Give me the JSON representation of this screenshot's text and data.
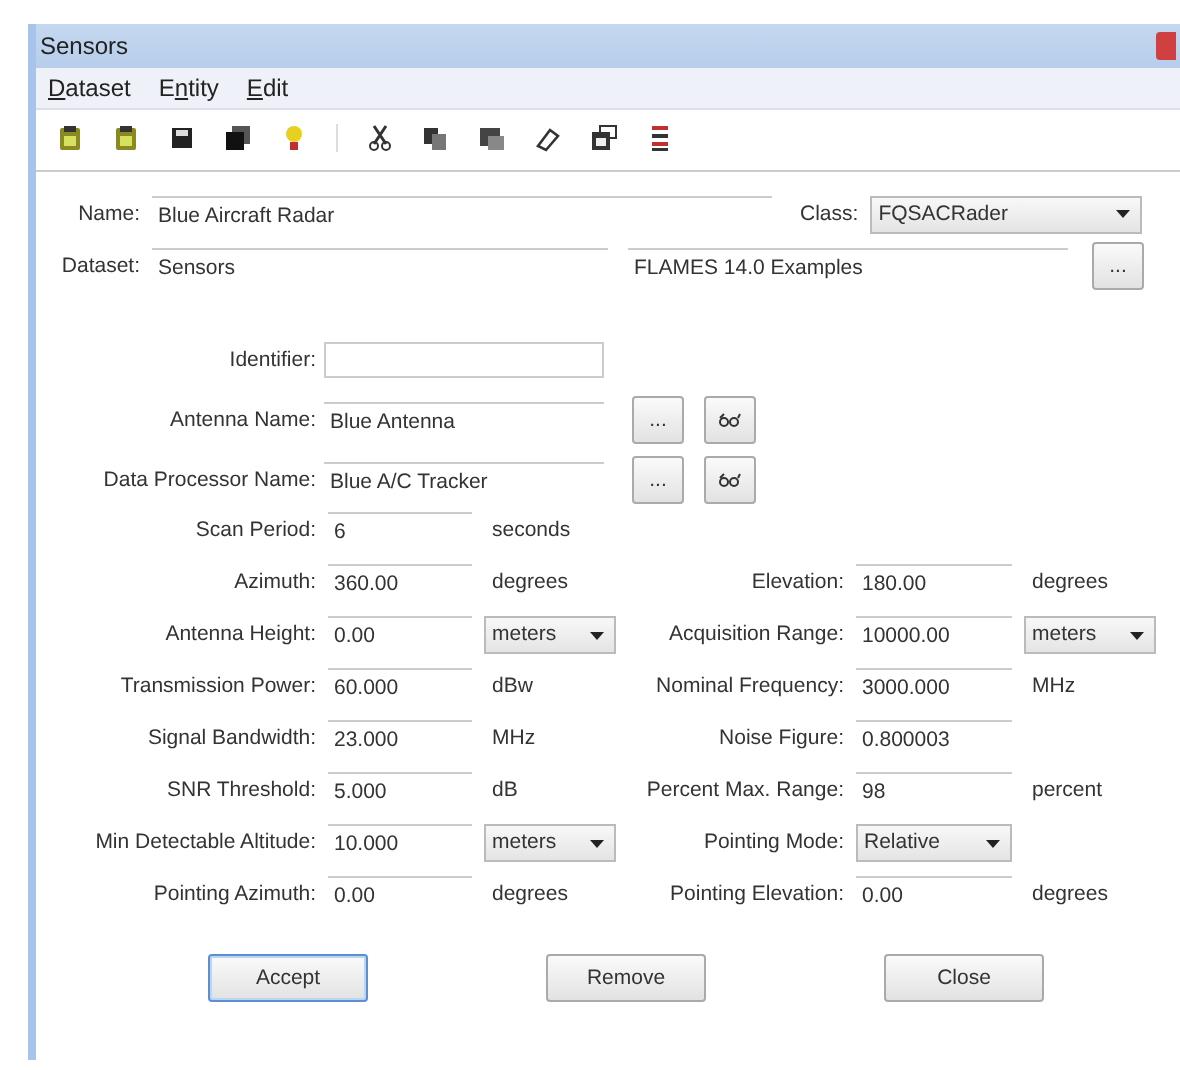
{
  "window": {
    "title": "Sensors"
  },
  "menu": [
    {
      "label": "Dataset",
      "kind": "first"
    },
    {
      "label": "Entity",
      "kind": "second"
    },
    {
      "label": "Edit",
      "kind": "first"
    }
  ],
  "header": {
    "name_label": "Name:",
    "name_value": "Blue Aircraft Radar",
    "class_label": "Class:",
    "class_value": "FQSACRader",
    "dataset_label": "Dataset:",
    "dataset_value": "Sensors",
    "source_value": "FLAMES 14.0 Examples",
    "browse_button": "..."
  },
  "references": [
    {
      "label": "Identifier:",
      "buttons": false
    },
    {
      "label": "Antenna Name:",
      "value": "Blue Antenna",
      "buttons": true,
      "browse": "..."
    },
    {
      "label": "Data Processor Name:",
      "value": "Blue A/C Tracker",
      "buttons": true,
      "browse": "..."
    }
  ],
  "parameters": [
    {
      "left": {
        "label": "Scan Period:",
        "value": "6",
        "kind": "field",
        "unit": {
          "text": "seconds",
          "kind": "text"
        }
      }
    },
    {
      "left": {
        "label": "Azimuth:",
        "value": "360.00",
        "kind": "field",
        "unit": {
          "text": "degrees",
          "kind": "text"
        }
      },
      "right": {
        "label": "Elevation:",
        "value": "180.00",
        "kind": "field",
        "unit": {
          "text": "degrees",
          "kind": "text"
        }
      }
    },
    {
      "left": {
        "label": "Antenna Height:",
        "value": "0.00",
        "kind": "field",
        "unit": {
          "text": "meters",
          "kind": "dropdown"
        }
      },
      "right": {
        "label": "Acquisition Range:",
        "value": "10000.00",
        "kind": "field",
        "unit": {
          "text": "meters",
          "kind": "dropdown"
        }
      }
    },
    {
      "left": {
        "label": "Transmission Power:",
        "value": "60.000",
        "kind": "field",
        "unit": {
          "text": "dBw",
          "kind": "text"
        }
      },
      "right": {
        "label": "Nominal Frequency:",
        "value": "3000.000",
        "kind": "field",
        "unit": {
          "text": "MHz",
          "kind": "text"
        }
      }
    },
    {
      "left": {
        "label": "Signal Bandwidth:",
        "value": "23.000",
        "kind": "field",
        "unit": {
          "text": "MHz",
          "kind": "text"
        }
      },
      "right": {
        "label": "Noise Figure:",
        "value": "0.800003",
        "kind": "field"
      }
    },
    {
      "left": {
        "label": "SNR Threshold:",
        "value": "5.000",
        "kind": "field",
        "unit": {
          "text": "dB",
          "kind": "text"
        }
      },
      "right": {
        "label": "Percent Max. Range:",
        "value": "98",
        "kind": "field",
        "unit": {
          "text": "percent",
          "kind": "text"
        }
      }
    },
    {
      "left": {
        "label": "Min Detectable Altitude:",
        "value": "10.000",
        "kind": "field",
        "unit": {
          "text": "meters",
          "kind": "dropdown"
        }
      },
      "right": {
        "label": "Pointing Mode:",
        "value": "Relative",
        "kind": "dropdown"
      }
    },
    {
      "left": {
        "label": "Pointing Azimuth:",
        "value": "0.00",
        "kind": "field",
        "unit": {
          "text": "degrees",
          "kind": "text"
        }
      },
      "right": {
        "label": "Pointing Elevation:",
        "value": "0.00",
        "kind": "field",
        "unit": {
          "text": "degrees",
          "kind": "text"
        }
      }
    }
  ],
  "buttons": [
    {
      "label": "Accept",
      "default": true
    },
    {
      "label": "Remove",
      "default": false
    },
    {
      "label": "Close",
      "default": false
    }
  ]
}
